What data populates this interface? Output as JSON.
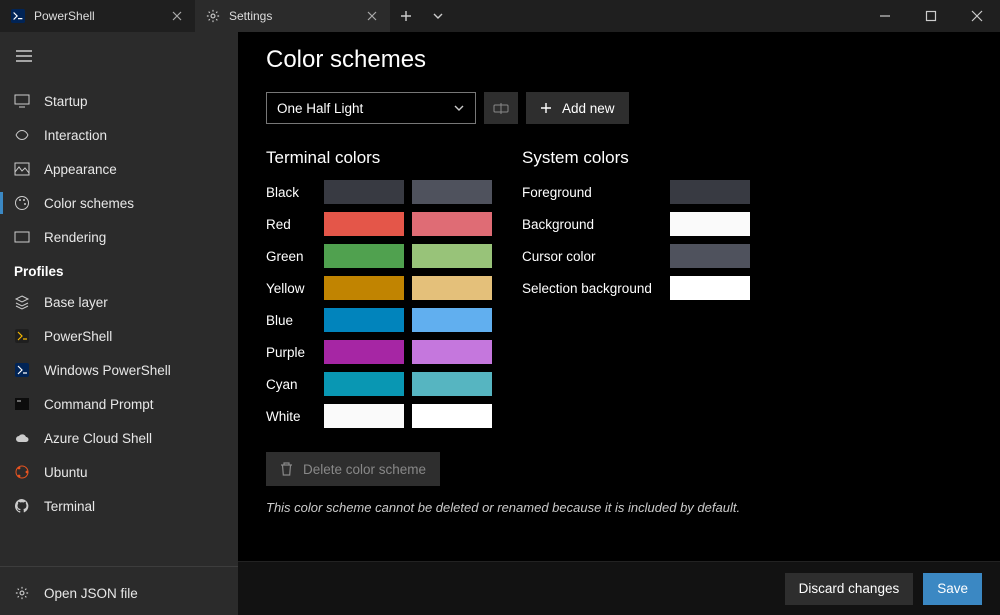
{
  "tabs": [
    {
      "label": "PowerShell"
    },
    {
      "label": "Settings"
    }
  ],
  "page_title": "Color schemes",
  "scheme_selector": {
    "value": "One Half Light"
  },
  "add_new_label": "Add new",
  "sidebar": {
    "items": [
      {
        "label": "Startup"
      },
      {
        "label": "Interaction"
      },
      {
        "label": "Appearance"
      },
      {
        "label": "Color schemes"
      },
      {
        "label": "Rendering"
      }
    ],
    "profiles_heading": "Profiles",
    "profiles": [
      {
        "label": "Base layer"
      },
      {
        "label": "PowerShell"
      },
      {
        "label": "Windows PowerShell"
      },
      {
        "label": "Command Prompt"
      },
      {
        "label": "Azure Cloud Shell"
      },
      {
        "label": "Ubuntu"
      },
      {
        "label": "Terminal"
      }
    ],
    "open_json_label": "Open JSON file"
  },
  "terminal_colors_heading": "Terminal colors",
  "system_colors_heading": "System colors",
  "terminal_colors": [
    {
      "name": "Black",
      "c1": "#383a42",
      "c2": "#4f525d"
    },
    {
      "name": "Red",
      "c1": "#e45649",
      "c2": "#df6c75"
    },
    {
      "name": "Green",
      "c1": "#50a14f",
      "c2": "#98c379"
    },
    {
      "name": "Yellow",
      "c1": "#c18401",
      "c2": "#e4c07a"
    },
    {
      "name": "Blue",
      "c1": "#0184bc",
      "c2": "#61afef"
    },
    {
      "name": "Purple",
      "c1": "#a626a4",
      "c2": "#c577dd"
    },
    {
      "name": "Cyan",
      "c1": "#0997b3",
      "c2": "#56b5c1"
    },
    {
      "name": "White",
      "c1": "#fafafa",
      "c2": "#ffffff"
    }
  ],
  "system_colors": [
    {
      "name": "Foreground",
      "c": "#383a42"
    },
    {
      "name": "Background",
      "c": "#fafafa"
    },
    {
      "name": "Cursor color",
      "c": "#4f525d"
    },
    {
      "name": "Selection background",
      "c": "#ffffff"
    }
  ],
  "delete_scheme_label": "Delete color scheme",
  "note_text": "This color scheme cannot be deleted or renamed because it is included by default.",
  "footer": {
    "discard": "Discard changes",
    "save": "Save"
  }
}
